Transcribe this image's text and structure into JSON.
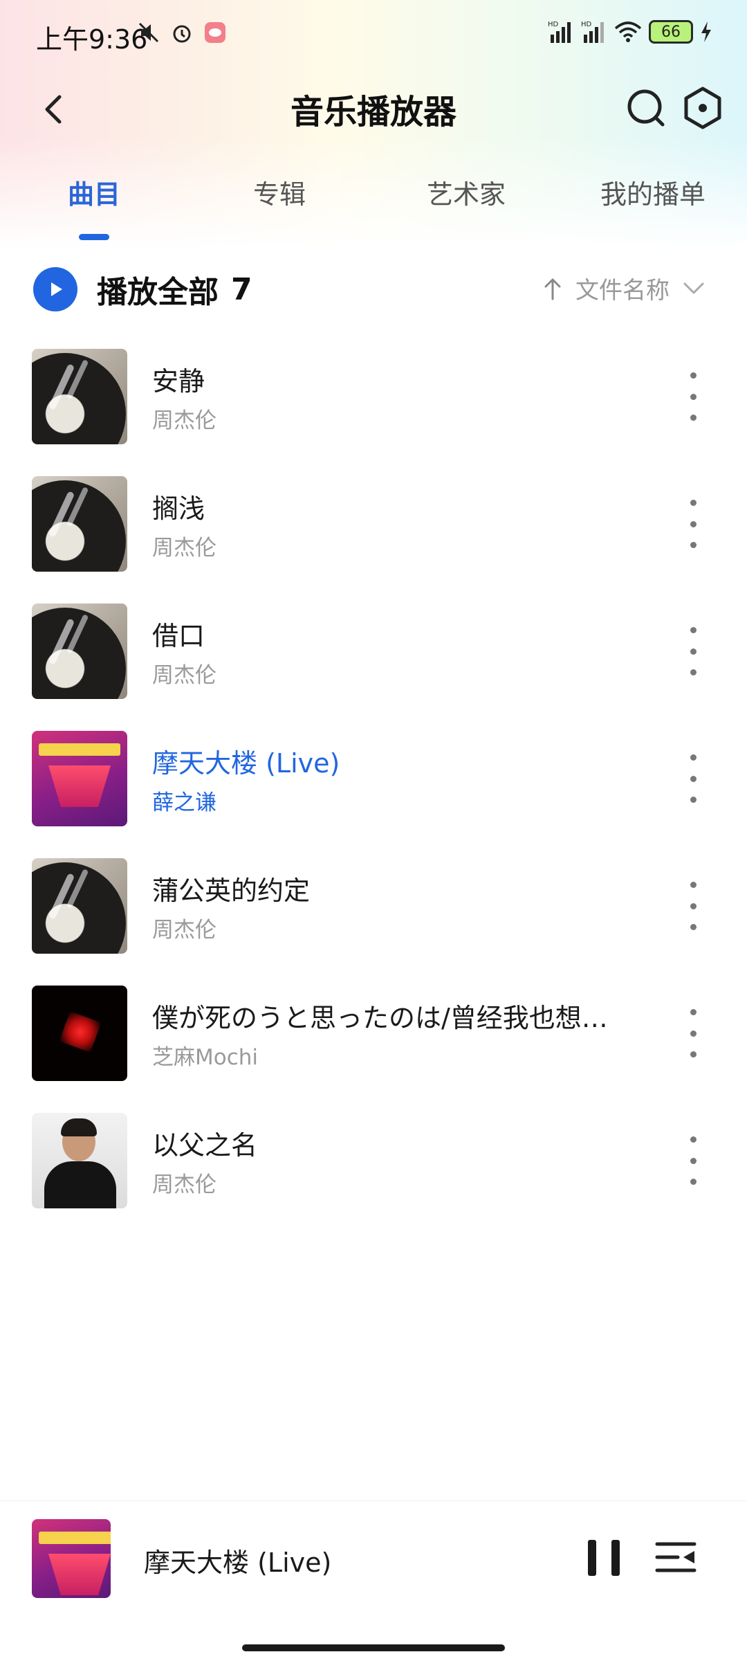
{
  "status_bar": {
    "time": "上午9:36",
    "battery": "66",
    "icons": [
      "mute-icon",
      "alarm-icon",
      "app-notification-icon",
      "hd-signal-icon",
      "hd-signal-icon",
      "wifi-icon",
      "battery-icon",
      "charging-icon"
    ]
  },
  "header": {
    "title": "音乐播放器"
  },
  "tabs": [
    {
      "label": "曲目",
      "active": true
    },
    {
      "label": "专辑",
      "active": false
    },
    {
      "label": "艺术家",
      "active": false
    },
    {
      "label": "我的播单",
      "active": false
    }
  ],
  "play_all": {
    "label": "播放全部",
    "count": "7"
  },
  "sort": {
    "label": "文件名称"
  },
  "songs": [
    {
      "title": "安静",
      "artist": "周杰伦",
      "cover": "vinyl",
      "active": false
    },
    {
      "title": "搁浅",
      "artist": "周杰伦",
      "cover": "vinyl",
      "active": false
    },
    {
      "title": "借口",
      "artist": "周杰伦",
      "cover": "vinyl",
      "active": false
    },
    {
      "title": "摩天大楼 (Live)",
      "artist": "薛之谦",
      "cover": "concert",
      "active": true
    },
    {
      "title": "蒲公英的约定",
      "artist": "周杰伦",
      "cover": "vinyl",
      "active": false
    },
    {
      "title": "僕が死のうと思ったのは/曾经我也想…",
      "artist": "芝麻Mochi",
      "cover": "dark-red",
      "active": false
    },
    {
      "title": "以父之名",
      "artist": "周杰伦",
      "cover": "portrait",
      "active": false
    }
  ],
  "now_playing": {
    "title": "摩天大楼 (Live)",
    "cover": "concert"
  },
  "colors": {
    "accent": "#2166e0",
    "text_primary": "#1a1a1a",
    "text_secondary": "#9a9a9a"
  }
}
